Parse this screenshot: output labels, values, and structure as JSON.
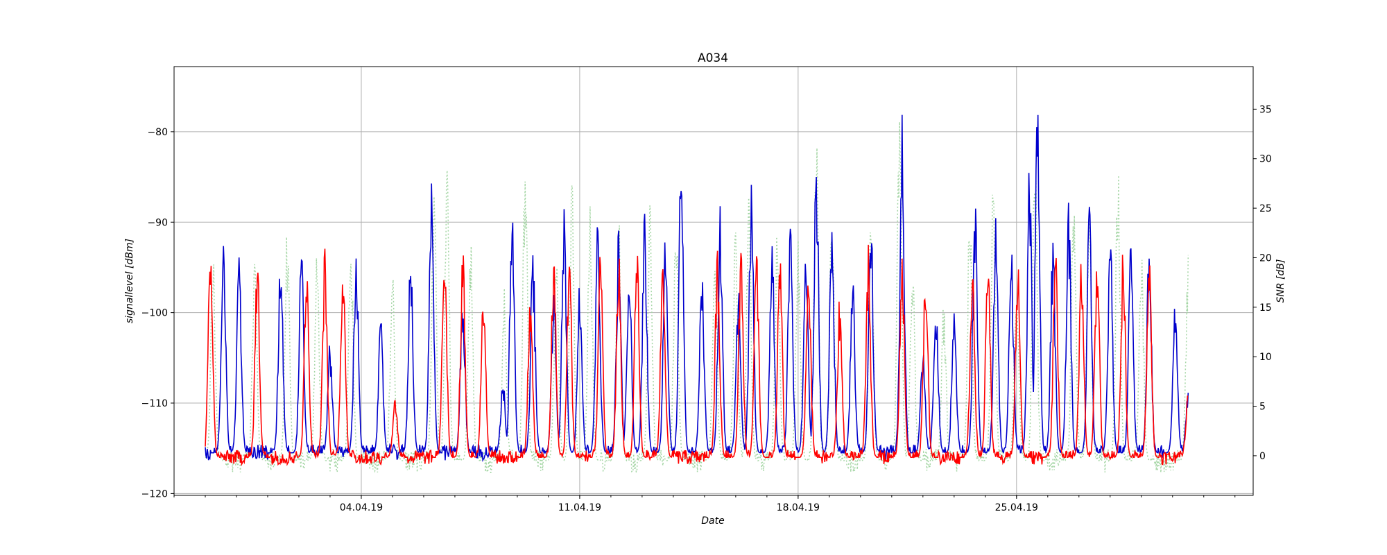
{
  "chart_data": {
    "type": "line",
    "title": "A034",
    "xlabel": "Date",
    "ylabel_left": "signallevel [dBm]",
    "ylabel_right": "SNR [dB]",
    "x_range": [
      "2019-03-29T00:00",
      "2019-05-02T14:00"
    ],
    "x_ticks": [
      {
        "date": "2019-04-04",
        "label": "04.04.19"
      },
      {
        "date": "2019-04-11",
        "label": "11.04.19"
      },
      {
        "date": "2019-04-18",
        "label": "18.04.19"
      },
      {
        "date": "2019-04-25",
        "label": "25.04.19"
      }
    ],
    "ylim_left": [
      -120.2,
      -72.8
    ],
    "yticks_left": [
      -120,
      -110,
      -100,
      -90,
      -80
    ],
    "ylim_right": [
      -4,
      39.3
    ],
    "yticks_right": [
      0,
      5,
      10,
      15,
      20,
      25,
      30,
      35
    ],
    "grid": true,
    "legend": "none",
    "series": [
      {
        "axis": "right",
        "style": "dotted",
        "color": "#a5d6a5",
        "baseline": -0.5,
        "noise": 1.2,
        "peaks": [
          [
            "2019-03-30T06:00",
            21
          ],
          [
            "2019-03-31T14:00",
            21.5
          ],
          [
            "2019-04-01T15:00",
            23.5
          ],
          [
            "2019-04-02T14:00",
            21
          ],
          [
            "2019-04-03T16:00",
            23.5
          ],
          [
            "2019-04-05T00:00",
            19.5
          ],
          [
            "2019-04-06T08:00",
            28
          ],
          [
            "2019-04-06T18:00",
            29.5
          ],
          [
            "2019-04-07T12:00",
            22.5
          ],
          [
            "2019-04-08T14:00",
            17
          ],
          [
            "2019-04-09T06:00",
            31
          ],
          [
            "2019-04-10T06:00",
            22
          ],
          [
            "2019-04-10T18:00",
            28.5
          ],
          [
            "2019-04-11T08:00",
            25.5
          ],
          [
            "2019-04-12T06:00",
            24.5
          ],
          [
            "2019-04-13T06:00",
            26.5
          ],
          [
            "2019-04-14T02:00",
            26.5
          ],
          [
            "2019-04-15T08:00",
            21.5
          ],
          [
            "2019-04-16T00:00",
            24.5
          ],
          [
            "2019-04-16T10:00",
            28.5
          ],
          [
            "2019-04-17T08:00",
            24
          ],
          [
            "2019-04-18T00:00",
            22.5
          ],
          [
            "2019-04-18T14:00",
            33
          ],
          [
            "2019-04-19T02:00",
            26.5
          ],
          [
            "2019-04-20T08:00",
            26
          ],
          [
            "2019-04-21T06:00",
            36.5
          ],
          [
            "2019-04-21T16:00",
            20
          ],
          [
            "2019-04-22T16:00",
            16
          ],
          [
            "2019-04-23T12:00",
            25.5
          ],
          [
            "2019-04-24T06:00",
            28
          ],
          [
            "2019-04-25T00:00",
            19.5
          ],
          [
            "2019-04-25T14:00",
            33.5
          ],
          [
            "2019-04-26T20:00",
            28
          ],
          [
            "2019-04-27T08:00",
            27
          ],
          [
            "2019-04-28T06:00",
            30.5
          ],
          [
            "2019-04-29T00:00",
            22
          ],
          [
            "2019-04-30T12:00",
            21
          ]
        ]
      },
      {
        "axis": "left",
        "style": "solid",
        "color": "#0000cc",
        "baseline": -115.5,
        "noise": 0.9,
        "peaks": [
          [
            "2019-03-30T14:00",
            -92.5
          ],
          [
            "2019-03-31T02:00",
            -93.5
          ],
          [
            "2019-04-01T10:00",
            -92
          ],
          [
            "2019-04-02T02:00",
            -92.5
          ],
          [
            "2019-04-03T00:00",
            -103
          ],
          [
            "2019-04-03T20:00",
            -92.5
          ],
          [
            "2019-04-04T15:00",
            -100.5
          ],
          [
            "2019-04-05T14:00",
            -92
          ],
          [
            "2019-04-06T06:00",
            -85.5
          ],
          [
            "2019-04-07T06:00",
            -97
          ],
          [
            "2019-04-08T13:00",
            -107
          ],
          [
            "2019-04-08T20:00",
            -86
          ],
          [
            "2019-04-09T12:00",
            -92.5
          ],
          [
            "2019-04-10T04:00",
            -97
          ],
          [
            "2019-04-10T12:00",
            -87
          ],
          [
            "2019-04-11T00:00",
            -96.5
          ],
          [
            "2019-04-11T14:00",
            -89.5
          ],
          [
            "2019-04-12T06:00",
            -90.5
          ],
          [
            "2019-04-12T14:00",
            -93
          ],
          [
            "2019-04-13T02:00",
            -88
          ],
          [
            "2019-04-13T18:00",
            -90.5
          ],
          [
            "2019-04-14T06:00",
            -81.5
          ],
          [
            "2019-04-14T22:00",
            -95
          ],
          [
            "2019-04-15T12:00",
            -87.5
          ],
          [
            "2019-04-16T02:00",
            -96.5
          ],
          [
            "2019-04-16T12:00",
            -85.5
          ],
          [
            "2019-04-17T04:00",
            -91.5
          ],
          [
            "2019-04-17T18:00",
            -89
          ],
          [
            "2019-04-18T06:00",
            -90.5
          ],
          [
            "2019-04-18T14:00",
            -81.5
          ],
          [
            "2019-04-19T02:00",
            -89.5
          ],
          [
            "2019-04-19T18:00",
            -96
          ],
          [
            "2019-04-20T08:00",
            -88.5
          ],
          [
            "2019-04-21T08:00",
            -78
          ],
          [
            "2019-04-22T00:00",
            -104
          ],
          [
            "2019-04-22T10:00",
            -98
          ],
          [
            "2019-04-23T00:00",
            -98.5
          ],
          [
            "2019-04-23T16:00",
            -86
          ],
          [
            "2019-04-24T08:00",
            -88.5
          ],
          [
            "2019-04-24T20:00",
            -92.5
          ],
          [
            "2019-04-25T10:00",
            -83
          ],
          [
            "2019-04-25T16:00",
            -75
          ],
          [
            "2019-04-26T04:00",
            -91.5
          ],
          [
            "2019-04-26T16:00",
            -87
          ],
          [
            "2019-04-27T08:00",
            -88
          ],
          [
            "2019-04-28T00:00",
            -89.5
          ],
          [
            "2019-04-28T16:00",
            -91.5
          ],
          [
            "2019-04-29T06:00",
            -92
          ],
          [
            "2019-04-30T02:00",
            -98
          ],
          [
            "2019-04-30T12:00",
            -108.5
          ]
        ]
      },
      {
        "axis": "left",
        "style": "solid",
        "color": "#ff0000",
        "baseline": -116,
        "noise": 0.8,
        "peaks": [
          [
            "2019-03-30T04:00",
            -92
          ],
          [
            "2019-03-31T16:00",
            -93
          ],
          [
            "2019-04-02T06:00",
            -92.5
          ],
          [
            "2019-04-02T20:00",
            -92.5
          ],
          [
            "2019-04-03T10:00",
            -92.5
          ],
          [
            "2019-04-05T02:00",
            -109
          ],
          [
            "2019-04-06T16:00",
            -91
          ],
          [
            "2019-04-07T06:00",
            -92.5
          ],
          [
            "2019-04-07T22:00",
            -96.5
          ],
          [
            "2019-04-09T10:00",
            -97.5
          ],
          [
            "2019-04-10T04:00",
            -92.5
          ],
          [
            "2019-04-10T16:00",
            -92.5
          ],
          [
            "2019-04-11T16:00",
            -92.5
          ],
          [
            "2019-04-12T06:00",
            -92.5
          ],
          [
            "2019-04-12T20:00",
            -92.5
          ],
          [
            "2019-04-13T16:00",
            -92.5
          ],
          [
            "2019-04-15T10:00",
            -92.5
          ],
          [
            "2019-04-16T04:00",
            -92.5
          ],
          [
            "2019-04-16T16:00",
            -92.5
          ],
          [
            "2019-04-17T10:00",
            -92.5
          ],
          [
            "2019-04-18T08:00",
            -92.5
          ],
          [
            "2019-04-19T08:00",
            -98
          ],
          [
            "2019-04-20T06:00",
            -92.5
          ],
          [
            "2019-04-21T08:00",
            -92.5
          ],
          [
            "2019-04-22T02:00",
            -93.5
          ],
          [
            "2019-04-23T14:00",
            -92.5
          ],
          [
            "2019-04-24T02:00",
            -92.5
          ],
          [
            "2019-04-25T01:00",
            -93
          ],
          [
            "2019-04-26T06:00",
            -92.5
          ],
          [
            "2019-04-27T02:00",
            -92.5
          ],
          [
            "2019-04-27T14:00",
            -92.5
          ],
          [
            "2019-04-28T10:00",
            -92.5
          ],
          [
            "2019-04-29T06:00",
            -92.5
          ],
          [
            "2019-04-30T12:00",
            -108
          ]
        ]
      }
    ]
  }
}
